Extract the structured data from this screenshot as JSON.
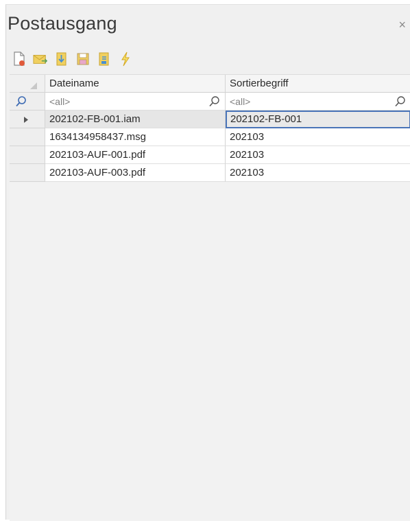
{
  "window": {
    "title": "Postausgang",
    "close_glyph": "×"
  },
  "toolbar": {
    "buttons": [
      {
        "name": "new-document-icon"
      },
      {
        "name": "email-icon"
      },
      {
        "name": "import-icon"
      },
      {
        "name": "save-icon"
      },
      {
        "name": "export-icon"
      },
      {
        "name": "lightning-icon"
      }
    ]
  },
  "grid": {
    "columns": [
      "Dateiname",
      "Sortierbegriff"
    ],
    "filter": {
      "placeholder_1": "<all>",
      "placeholder_2": "<all>"
    },
    "rows": [
      {
        "dateiname": "202102-FB-001.iam",
        "sortierbegriff": "202102-FB-001"
      },
      {
        "dateiname": "1634134958437.msg",
        "sortierbegriff": "202103"
      },
      {
        "dateiname": "202103-AUF-001.pdf",
        "sortierbegriff": "202103"
      },
      {
        "dateiname": "202103-AUF-003.pdf",
        "sortierbegriff": "202103"
      }
    ]
  },
  "colors": {
    "selection_border": "#4a74b8",
    "icon_yellow": "#e8c94a"
  }
}
